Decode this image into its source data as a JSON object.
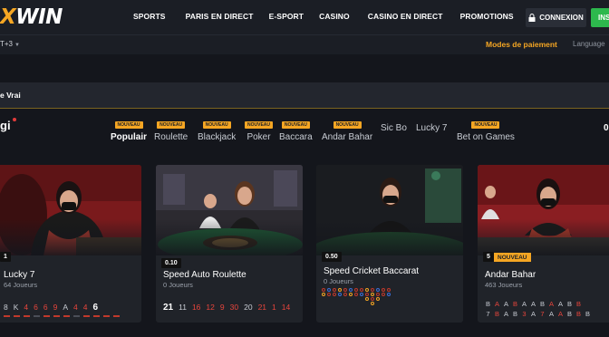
{
  "brand": {
    "logo_x": "X",
    "logo_rest": "WIN"
  },
  "nav": [
    "SPORTS",
    "PARIS EN DIRECT",
    "E-SPORT",
    "CASINO",
    "CASINO EN DIRECT",
    "PROMOTIONS"
  ],
  "auth": {
    "login": "CONNEXION",
    "signup": "INS"
  },
  "subbar": {
    "timezone": "T+3",
    "payment": "Modes de paiement",
    "language": "Language"
  },
  "section": {
    "title": "e Vrai"
  },
  "provider": {
    "name": "gi"
  },
  "categories": [
    {
      "label": "Populair",
      "badge": "NOUVEAU",
      "active": true
    },
    {
      "label": "Roulette",
      "badge": "NOUVEAU",
      "active": false
    },
    {
      "label": "Blackjack",
      "badge": "NOUVEAU",
      "active": false
    },
    {
      "label": "Poker",
      "badge": "NOUVEAU",
      "active": false
    },
    {
      "label": "Baccara",
      "badge": "NOUVEAU",
      "active": false
    },
    {
      "label": "Andar Bahar",
      "badge": "NOUVEAU",
      "active": false
    },
    {
      "label": "Sic Bo",
      "badge": "",
      "active": false
    },
    {
      "label": "Lucky 7",
      "badge": "",
      "active": false
    },
    {
      "label": "Bet on Games",
      "badge": "NOUVEAU",
      "active": false
    }
  ],
  "counter": "0",
  "games": [
    {
      "title": "Lucky 7",
      "players": "64 Joueurs",
      "min_bet": "1",
      "new": "",
      "results": [
        "8",
        "K",
        "4",
        "6",
        "6",
        "9",
        "A",
        "4",
        "4",
        "6"
      ]
    },
    {
      "title": "Speed Auto Roulette",
      "players": "0 Joueurs",
      "min_bet": "0.10",
      "new": "",
      "results": [
        "21",
        "11",
        "16",
        "12",
        "9",
        "30",
        "20",
        "21",
        "1",
        "14"
      ]
    },
    {
      "title": "Speed Cricket Baccarat",
      "players": "0 Joueurs",
      "min_bet": "0.50",
      "new": "",
      "results": []
    },
    {
      "title": "Andar Bahar",
      "players": "463 Joueurs",
      "min_bet": "5",
      "new": "NOUVEAU",
      "results": [
        "B",
        "A",
        "A",
        "B",
        "A",
        "A",
        "B",
        "A",
        "A",
        "B",
        "B",
        "7",
        "B",
        "A",
        "B",
        "3",
        "A",
        "7",
        "A",
        "A",
        "B",
        "B",
        "B"
      ]
    }
  ],
  "colors": {
    "accent": "#f5a623",
    "signup": "#2db84d",
    "red": "#e8453c"
  }
}
